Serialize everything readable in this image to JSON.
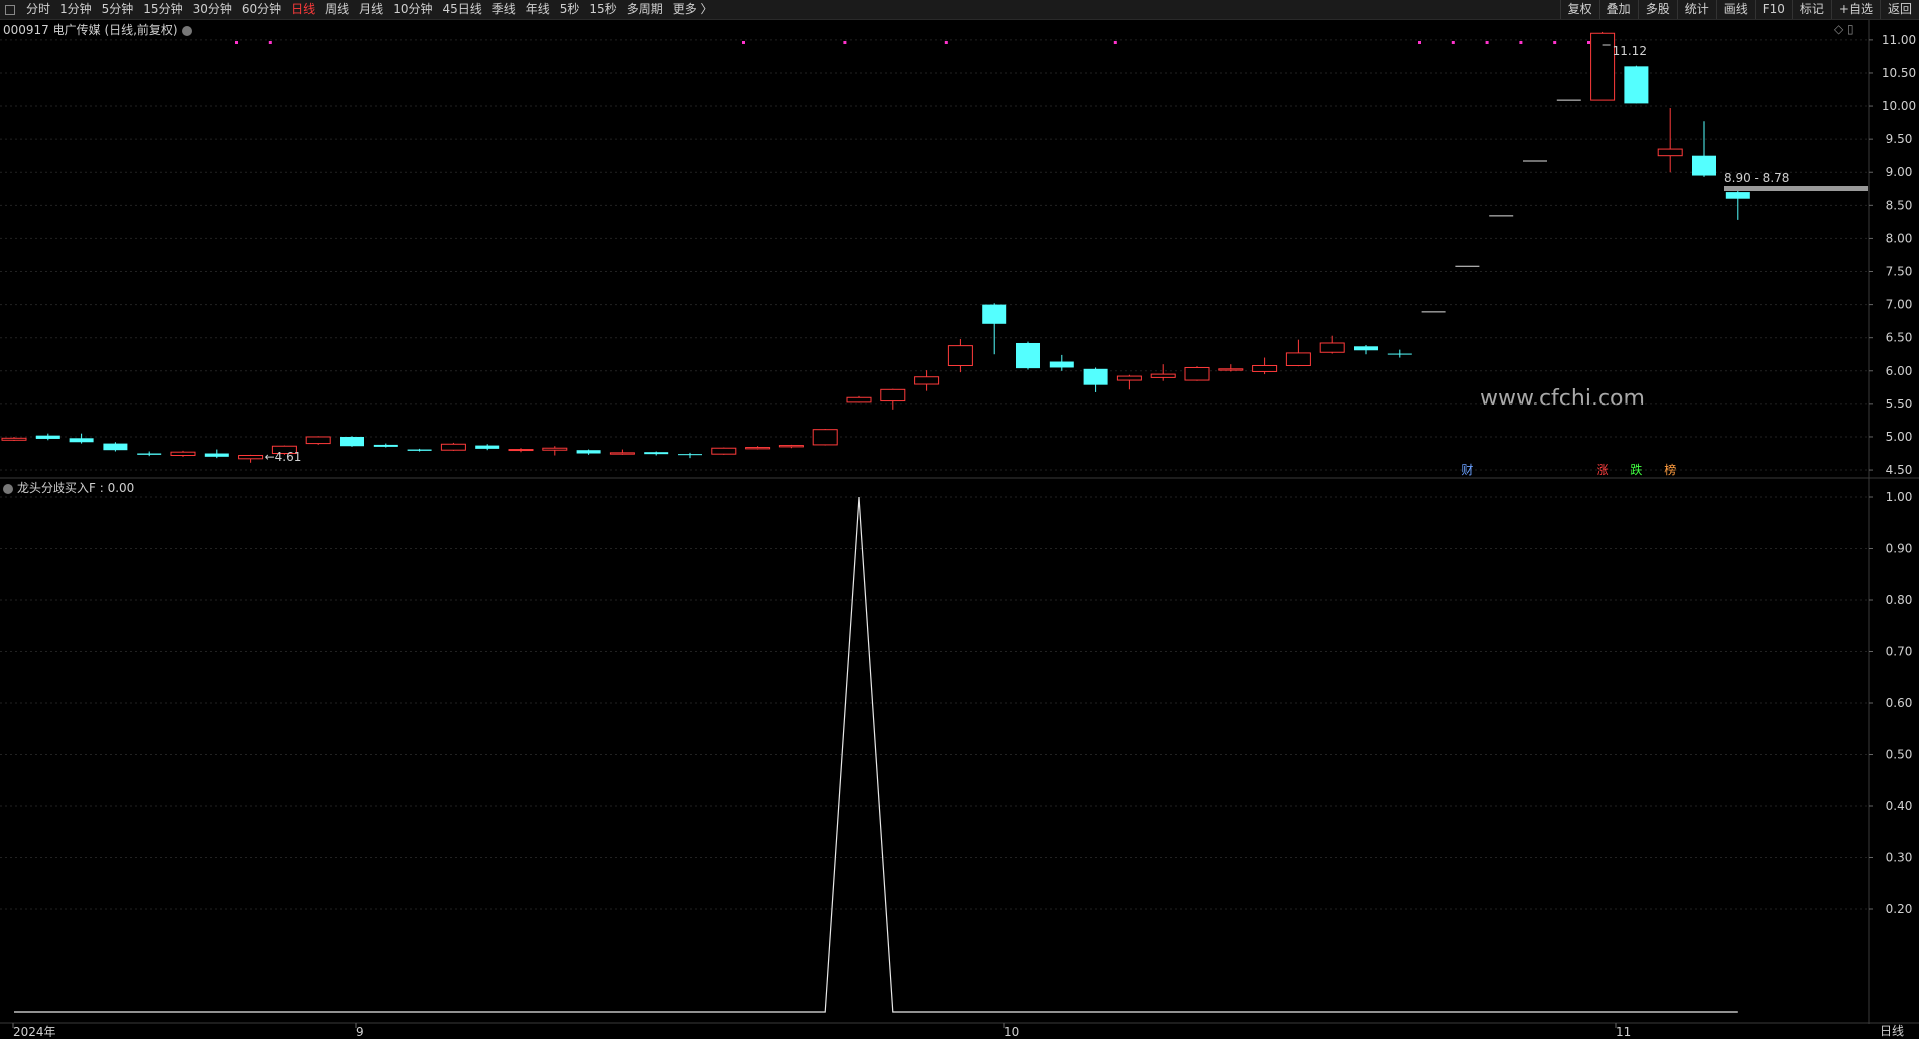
{
  "toolbar": {
    "left_items": [
      "分时",
      "1分钟",
      "5分钟",
      "15分钟",
      "30分钟",
      "60分钟",
      "日线",
      "周线",
      "月线",
      "10分钟",
      "45日线",
      "季线",
      "年线",
      "5秒",
      "15秒",
      "多周期",
      "更多 〉"
    ],
    "active": "日线",
    "right_items": [
      "复权",
      "叠加",
      "多股",
      "统计",
      "画线",
      "F10",
      "标记",
      "+自选",
      "返回"
    ]
  },
  "stock_label": "000917 电广传媒 (日线,前复权)",
  "indicator_label": "龙头分歧买入F : 0.00",
  "watermark": "www.cfchi.com",
  "period_label": "日线",
  "annotations": {
    "high": "11.12",
    "low": "4.61",
    "range": "8.90 - 8.78",
    "markers": [
      "财",
      "涨",
      "跌",
      "榜"
    ]
  },
  "colors": {
    "up": "#ff3b3b",
    "down": "#54ffff",
    "flat": "#e0e0e0",
    "signal": "#ff33cc"
  },
  "chart_data": [
    {
      "type": "candlestick",
      "title": "000917 电广传媒 (日线,前复权)",
      "y_ticks": [
        "11.00",
        "10.50",
        "10.00",
        "9.50",
        "9.00",
        "8.50",
        "8.00",
        "7.50",
        "7.00",
        "6.50",
        "6.00",
        "5.50",
        "5.00",
        "4.50"
      ],
      "x_ticks": [
        "2024年",
        "9",
        "10",
        "11"
      ],
      "ylim": [
        4.38,
        11.27
      ],
      "candles": [
        {
          "o": 4.95,
          "c": 4.98,
          "h": 5.0,
          "l": 4.94
        },
        {
          "o": 5.02,
          "c": 4.97,
          "h": 5.05,
          "l": 4.95
        },
        {
          "o": 4.98,
          "c": 4.92,
          "h": 5.05,
          "l": 4.9
        },
        {
          "o": 4.9,
          "c": 4.8,
          "h": 4.92,
          "l": 4.78
        },
        {
          "o": 4.75,
          "c": 4.73,
          "h": 4.78,
          "l": 4.71
        },
        {
          "o": 4.72,
          "c": 4.77,
          "h": 4.79,
          "l": 4.7
        },
        {
          "o": 4.75,
          "c": 4.7,
          "h": 4.81,
          "l": 4.68
        },
        {
          "o": 4.67,
          "c": 4.72,
          "h": 4.73,
          "l": 4.61
        },
        {
          "o": 4.75,
          "c": 4.86,
          "h": 4.87,
          "l": 4.73
        },
        {
          "o": 4.9,
          "c": 5.0,
          "h": 5.01,
          "l": 4.88
        },
        {
          "o": 5.0,
          "c": 4.86,
          "h": 5.01,
          "l": 4.85
        },
        {
          "o": 4.88,
          "c": 4.85,
          "h": 4.9,
          "l": 4.84
        },
        {
          "o": 4.81,
          "c": 4.79,
          "h": 4.82,
          "l": 4.78
        },
        {
          "o": 4.8,
          "c": 4.89,
          "h": 4.91,
          "l": 4.79
        },
        {
          "o": 4.87,
          "c": 4.82,
          "h": 4.89,
          "l": 4.8
        },
        {
          "o": 4.8,
          "c": 4.81,
          "h": 4.83,
          "l": 4.77
        },
        {
          "o": 4.8,
          "c": 4.83,
          "h": 4.86,
          "l": 4.72
        },
        {
          "o": 4.8,
          "c": 4.75,
          "h": 4.81,
          "l": 4.73
        },
        {
          "o": 4.74,
          "c": 4.76,
          "h": 4.81,
          "l": 4.73
        },
        {
          "o": 4.77,
          "c": 4.74,
          "h": 4.78,
          "l": 4.72
        },
        {
          "o": 4.74,
          "c": 4.74,
          "h": 4.76,
          "l": 4.68
        },
        {
          "o": 4.74,
          "c": 4.83,
          "h": 4.84,
          "l": 4.73
        },
        {
          "o": 4.82,
          "c": 4.84,
          "h": 4.86,
          "l": 4.81
        },
        {
          "o": 4.85,
          "c": 4.87,
          "h": 4.88,
          "l": 4.83
        },
        {
          "o": 4.88,
          "c": 5.11,
          "h": 5.12,
          "l": 4.87
        },
        {
          "o": 5.53,
          "c": 5.6,
          "h": 5.62,
          "l": 5.52
        },
        {
          "o": 5.55,
          "c": 5.72,
          "h": 5.73,
          "l": 5.41
        },
        {
          "o": 5.8,
          "c": 5.91,
          "h": 6.01,
          "l": 5.7
        },
        {
          "o": 6.08,
          "c": 6.38,
          "h": 6.48,
          "l": 5.98
        },
        {
          "o": 7.0,
          "c": 6.71,
          "h": 7.02,
          "l": 6.25
        },
        {
          "o": 6.42,
          "c": 6.04,
          "h": 6.44,
          "l": 6.02
        },
        {
          "o": 6.14,
          "c": 6.05,
          "h": 6.24,
          "l": 6.0
        },
        {
          "o": 6.03,
          "c": 5.79,
          "h": 6.05,
          "l": 5.68
        },
        {
          "o": 5.86,
          "c": 5.92,
          "h": 5.94,
          "l": 5.72
        },
        {
          "o": 5.9,
          "c": 5.95,
          "h": 6.1,
          "l": 5.85
        },
        {
          "o": 5.86,
          "c": 6.05,
          "h": 6.07,
          "l": 5.85
        },
        {
          "o": 6.01,
          "c": 6.03,
          "h": 6.1,
          "l": 5.99
        },
        {
          "o": 5.99,
          "c": 6.08,
          "h": 6.2,
          "l": 5.95
        },
        {
          "o": 6.08,
          "c": 6.27,
          "h": 6.47,
          "l": 6.07
        },
        {
          "o": 6.28,
          "c": 6.42,
          "h": 6.53,
          "l": 6.26
        },
        {
          "o": 6.37,
          "c": 6.31,
          "h": 6.39,
          "l": 6.25
        },
        {
          "o": 6.26,
          "c": 6.26,
          "h": 6.32,
          "l": 6.2
        },
        {
          "o": 6.89,
          "c": 6.89,
          "h": 6.89,
          "l": 6.89
        },
        {
          "o": 7.58,
          "c": 7.58,
          "h": 7.58,
          "l": 7.58
        },
        {
          "o": 8.34,
          "c": 8.34,
          "h": 8.34,
          "l": 8.34
        },
        {
          "o": 9.17,
          "c": 9.17,
          "h": 9.17,
          "l": 9.17
        },
        {
          "o": 10.09,
          "c": 10.09,
          "h": 10.09,
          "l": 10.09
        },
        {
          "o": 10.09,
          "c": 11.1,
          "h": 11.12,
          "l": 10.09
        },
        {
          "o": 10.6,
          "c": 10.04,
          "h": 10.61,
          "l": 10.04
        },
        {
          "o": 9.25,
          "c": 9.35,
          "h": 9.97,
          "l": 9.0
        },
        {
          "o": 9.25,
          "c": 8.95,
          "h": 9.77,
          "l": 8.93
        },
        {
          "o": 8.7,
          "c": 8.6,
          "h": 8.73,
          "l": 8.28
        }
      ],
      "signal_dots_at": [
        7,
        8,
        22,
        25,
        28,
        33,
        42,
        43,
        44,
        45,
        46,
        47
      ],
      "markers_at": [
        43,
        47,
        48,
        49
      ]
    },
    {
      "type": "line",
      "title": "龙头分歧买入F",
      "y_ticks": [
        "1.00",
        "0.90",
        "0.80",
        "0.70",
        "0.60",
        "0.50",
        "0.40",
        "0.30",
        "0.20"
      ],
      "ylim": [
        0,
        1
      ],
      "values": [
        0,
        0,
        0,
        0,
        0,
        0,
        0,
        0,
        0,
        0,
        0,
        0,
        0,
        0,
        0,
        0,
        0,
        0,
        0,
        0,
        0,
        0,
        0,
        0,
        0,
        1,
        0,
        0,
        0,
        0,
        0,
        0,
        0,
        0,
        0,
        0,
        0,
        0,
        0,
        0,
        0,
        0,
        0,
        0,
        0,
        0,
        0,
        0,
        0,
        0,
        0,
        0
      ]
    }
  ]
}
